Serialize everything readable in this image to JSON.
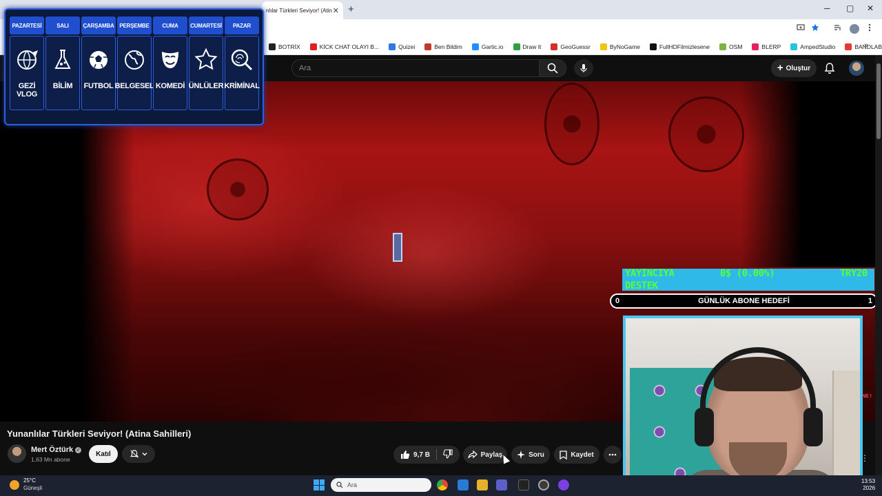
{
  "browser": {
    "tab_title": "nlılar Türkleri Seviyor! (Atin",
    "tab_close": "✕",
    "new_tab": "+",
    "window_controls": [
      "─",
      "▢",
      "✕"
    ],
    "bookmarks": [
      {
        "label": "BOTRİX",
        "color": "#222222"
      },
      {
        "label": "KİCK CHAT OLAYI B...",
        "color": "#e02020"
      },
      {
        "label": "Quizei",
        "color": "#2c7be5"
      },
      {
        "label": "Ben Bildim",
        "color": "#c0392b"
      },
      {
        "label": "Gartic.io",
        "color": "#1e90ff"
      },
      {
        "label": "Draw It",
        "color": "#2ea043"
      },
      {
        "label": "GeoGuessr",
        "color": "#d32f2f"
      },
      {
        "label": "ByNoGame",
        "color": "#f1c40f"
      },
      {
        "label": "FullHDFilmizlesene",
        "color": "#111111"
      },
      {
        "label": "OSM",
        "color": "#7cb342"
      },
      {
        "label": "BLERP",
        "color": "#e91e63"
      },
      {
        "label": "AmpedStudio",
        "color": "#26c6da"
      },
      {
        "label": "BANDLAB",
        "color": "#e53935"
      }
    ],
    "bookmarks_more": "»"
  },
  "youtube": {
    "search_placeholder": "Ara",
    "create_label": "Oluştur"
  },
  "schedule": {
    "days": [
      {
        "day": "PAZARTESİ",
        "label": "GEZİ VLOG",
        "icon": "globe-plane-icon"
      },
      {
        "day": "SALI",
        "label": "BİLİM",
        "icon": "science-flask-icon"
      },
      {
        "day": "ÇARŞAMBA",
        "label": "FUTBOL",
        "icon": "soccer-ball-icon"
      },
      {
        "day": "PERŞEMBE",
        "label": "BELGESEL",
        "icon": "earth-icon"
      },
      {
        "day": "CUMA",
        "label": "KOMEDİ",
        "icon": "comedy-mask-icon"
      },
      {
        "day": "CUMARTESİ",
        "label": "ÜNLÜLER",
        "icon": "star-icon"
      },
      {
        "day": "PAZAR",
        "label": "KRİMİNAL",
        "icon": "fingerprint-magnifier-icon"
      }
    ]
  },
  "donation": {
    "label_line1": "YAYINCIYA",
    "label_line2": "DESTEK",
    "progress": "0$ (0.00%)",
    "goal": "TRY20"
  },
  "sub_goal": {
    "current": "0",
    "title": "GÜNLÜK ABONE HEDEFİ",
    "target": "1"
  },
  "video": {
    "title": "Yunanlılar Türkleri Seviyor! (Atina Sahilleri)",
    "channel": "Mert Öztürk",
    "verified_mark": "✓",
    "subscribers": "1,63 Mn abone",
    "join_label": "Katıl",
    "likes": "9,7 B",
    "share_label": "Paylaş",
    "ask_label": "Soru",
    "save_label": "Kaydet",
    "side_overlay_text": "NE !"
  },
  "taskbar": {
    "temperature": "25°C",
    "weather": "Güneşli",
    "search_placeholder": "Ara",
    "time": "13:53",
    "date": "2026"
  }
}
